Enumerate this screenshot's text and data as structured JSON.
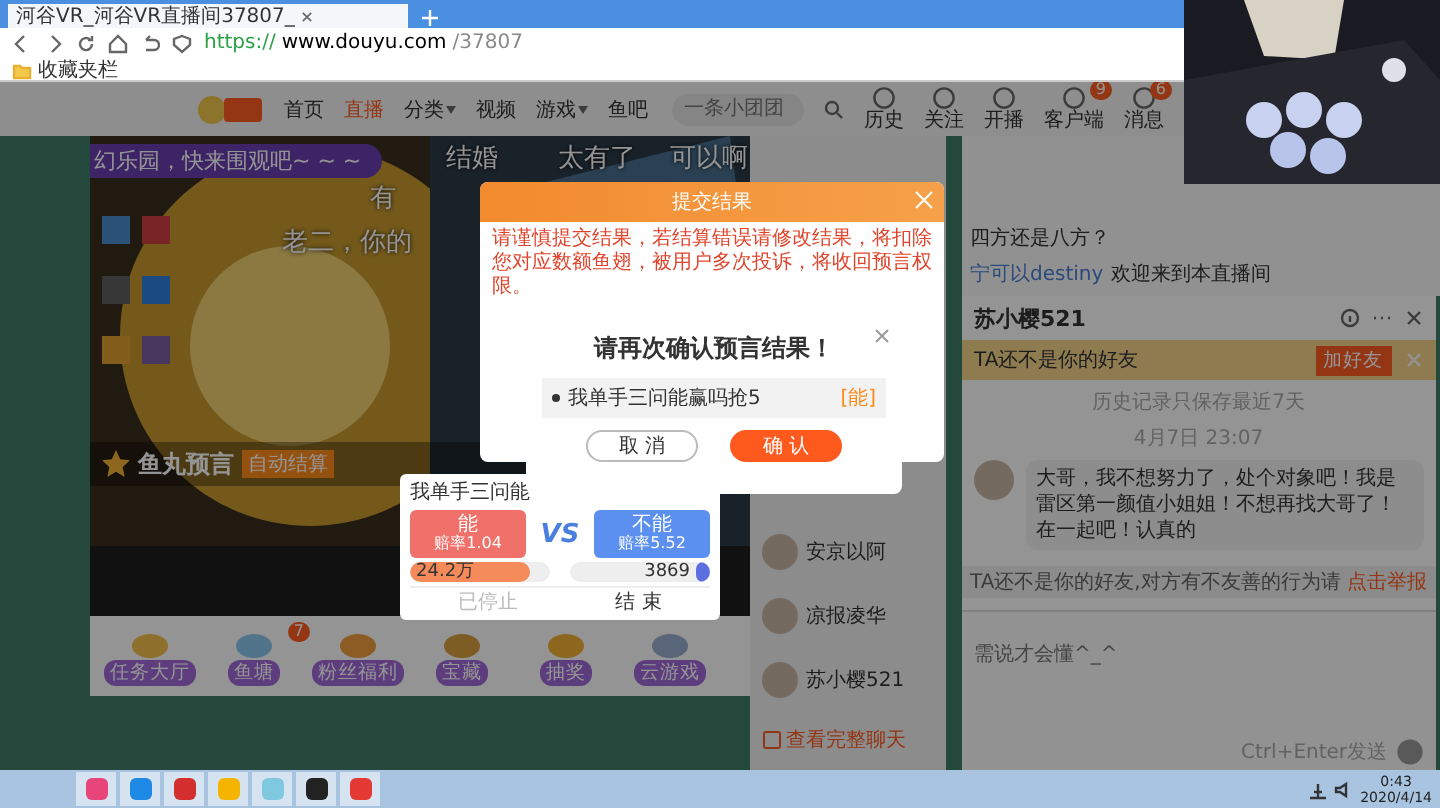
{
  "browser": {
    "tab_title": "河谷VR_河谷VR直播间37807_",
    "url_scheme": "https://",
    "url_host": "www.douyu.com",
    "url_path": "/37807",
    "bookmarks_bar": "收藏夹栏"
  },
  "header": {
    "nav": [
      {
        "label": "首页",
        "selected": false,
        "dropdown": false
      },
      {
        "label": "直播",
        "selected": true,
        "dropdown": false
      },
      {
        "label": "分类",
        "selected": false,
        "dropdown": true
      },
      {
        "label": "视频",
        "selected": false,
        "dropdown": false
      },
      {
        "label": "游戏",
        "selected": false,
        "dropdown": true
      },
      {
        "label": "鱼吧",
        "selected": false,
        "dropdown": false
      }
    ],
    "search": {
      "placeholder": "一条小团团"
    },
    "actions": [
      {
        "label": "历史"
      },
      {
        "label": "关注"
      },
      {
        "label": "开播"
      },
      {
        "label": "客户端",
        "badge": "9"
      },
      {
        "label": "消息",
        "badge": "6"
      }
    ]
  },
  "stream": {
    "banner": "幻乐园，快来围观吧~ ~ ~",
    "danmaku": [
      "结婚",
      "太有了",
      "有",
      "可以啊",
      "老二，你的"
    ],
    "prediction_title": "鱼丸预言",
    "prediction_badge": "自动结算",
    "prediction": {
      "question": "我单手三问能",
      "options": [
        {
          "label": "能",
          "odds": "赔率1.04",
          "pool": "24.2万",
          "level": 0.85
        },
        {
          "label": "不能",
          "odds": "赔率5.52",
          "pool": "3869",
          "level": 0.1
        }
      ],
      "vs": "VS",
      "status": "已停止",
      "end": "结 束"
    }
  },
  "gifts": [
    {
      "label": "任务大厅"
    },
    {
      "label": "鱼塘",
      "badge": "7"
    },
    {
      "label": "粉丝福利"
    },
    {
      "label": "宝藏"
    },
    {
      "label": "抽奖"
    },
    {
      "label": "云游戏"
    }
  ],
  "friends": {
    "items": [
      "安京以阿",
      "凉报凌华",
      "苏小樱521"
    ],
    "view_all": "查看完整聊天"
  },
  "room_chat": [
    {
      "text": "四方还是八方？"
    },
    {
      "text": "欢迎来到本直播间",
      "user": "宁可以destiny"
    }
  ],
  "chat": {
    "name": "苏小樱521",
    "notice": "TA还不是你的好友",
    "add_friend": "加好友",
    "history": "历史记录只保存最近7天",
    "time": "4月7日 23:07",
    "message": "大哥，我不想努力了，处个对象吧！我是雷区第一颜值小姐姐！不想再找大哥了！在一起吧！认真的",
    "warning": "TA还不是你的好友,对方有不友善的行为请",
    "report": "点击举报",
    "input_placeholder": "需说才会懂^_^",
    "send_hint": "Ctrl+Enter发送"
  },
  "submit_dialog": {
    "title": "提交结果",
    "warning": "请谨慎提交结果，若结算错误请修改结果，将扣除您对应数额鱼翅，被用户多次投诉，将收回预言权限。"
  },
  "confirm_dialog": {
    "title": "请再次确认预言结果！",
    "item": "我单手三问能赢吗抢5",
    "answer": "[能]",
    "cancel": "取 消",
    "confirm": "确 认"
  },
  "taskbar": {
    "apps": [
      {
        "color": "#e8457a"
      },
      {
        "color": "#1e88e5"
      },
      {
        "color": "#d32f2f"
      },
      {
        "color": "#f5b400"
      },
      {
        "color": "#7fc8e0"
      },
      {
        "color": "#222222"
      },
      {
        "color": "#e53935"
      }
    ],
    "time": "0:43",
    "date": "2020/4/14"
  }
}
